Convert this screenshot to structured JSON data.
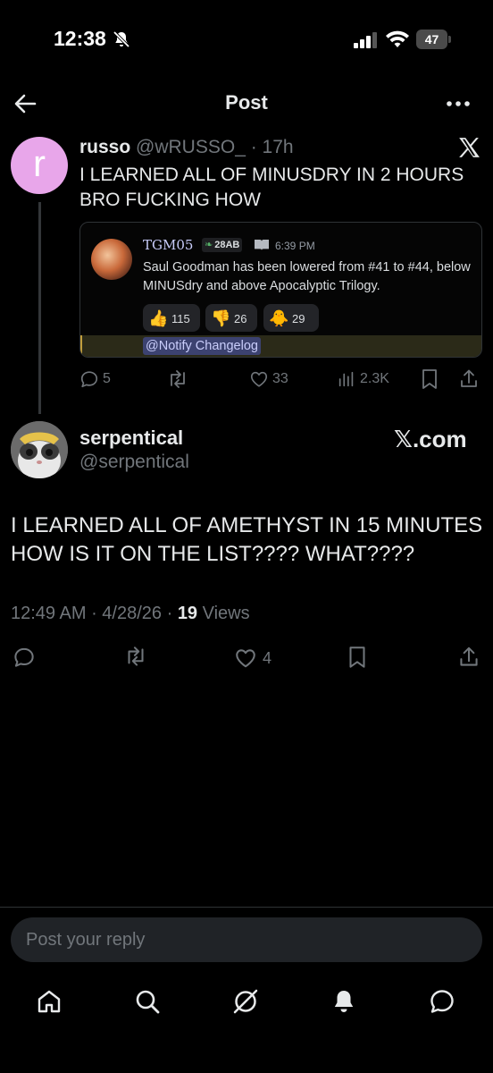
{
  "status_bar": {
    "time": "12:38",
    "battery": "47"
  },
  "nav": {
    "title": "Post"
  },
  "quoted_tweet": {
    "avatar_letter": "r",
    "display_name": "russo",
    "handle": "@wRUSSO_",
    "separator": " · ",
    "age": "17h",
    "text": "I LEARNED ALL OF MINUSDRY IN 2 HOURS BRO FUCKING HOW",
    "embed": {
      "username": "TGM05",
      "badge": "28AB",
      "time": "6:39 PM",
      "message": "Saul Goodman has been lowered from #41 to #44, below MINUSdry and above Apocalyptic Trilogy.",
      "reactions": [
        {
          "emoji": "👍",
          "count": "115"
        },
        {
          "emoji": "👎",
          "count": "26"
        },
        {
          "emoji": "🐥",
          "count": "29"
        }
      ],
      "mention": "@Notify Changelog"
    },
    "actions": {
      "replies": "5",
      "retweets": "",
      "likes": "33",
      "views": "2.3K"
    }
  },
  "main_tweet": {
    "display_name": "serpentical",
    "handle": "@serpentical",
    "source_label": "𝕏.com",
    "text": "I LEARNED ALL OF AMETHYST IN 15 MINUTES HOW IS IT ON THE LIST???? WHAT????",
    "time": "12:49 AM",
    "date": "4/28/26",
    "views_count": "19",
    "views_label": "Views",
    "dot": " · ",
    "actions": {
      "likes": "4"
    }
  },
  "reply": {
    "placeholder": "Post your reply"
  },
  "colors": {
    "background": "#000000",
    "text": "#e7e9ea",
    "muted": "#71767b",
    "avatar_pink": "#e8a6ea",
    "mention_bg": "#3c4270"
  }
}
